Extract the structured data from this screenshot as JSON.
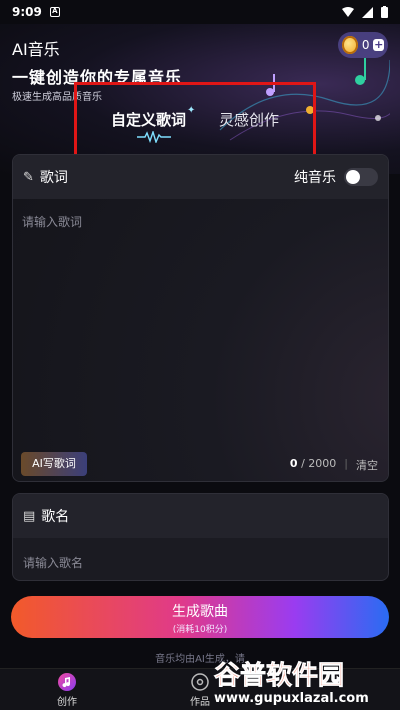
{
  "status_bar": {
    "time": "9:09"
  },
  "app": {
    "title": "AI音乐"
  },
  "coins": {
    "count": "0"
  },
  "hero": {
    "headline": "一键创造你的专属音乐",
    "subline": "极速生成高品质音乐"
  },
  "tabs": [
    {
      "label": "自定义歌词",
      "active": true
    },
    {
      "label": "灵感创作",
      "active": false
    }
  ],
  "lyrics_card": {
    "title": "歌词",
    "pure_music_label": "纯音乐",
    "pure_music_on": false,
    "placeholder": "请输入歌词",
    "ai_write_label": "AI写歌词",
    "count_current": "0",
    "count_max": "/ 2000",
    "clear_label": "清空"
  },
  "name_card": {
    "title": "歌名",
    "placeholder": "请输入歌名"
  },
  "generate": {
    "label": "生成歌曲",
    "sublabel": "(消耗10积分)"
  },
  "disclaimer": "音乐均由AI生成，请",
  "bottom_nav": [
    {
      "label": "创作",
      "active": true
    },
    {
      "label": "作品",
      "active": false
    }
  ],
  "watermark": {
    "brand": "谷普软件园",
    "url": "www.gupuxlazal.com"
  },
  "colors": {
    "accent_red": "#e01616",
    "gradient_start": "#f25a2a",
    "gradient_end": "#2a6cf2"
  }
}
